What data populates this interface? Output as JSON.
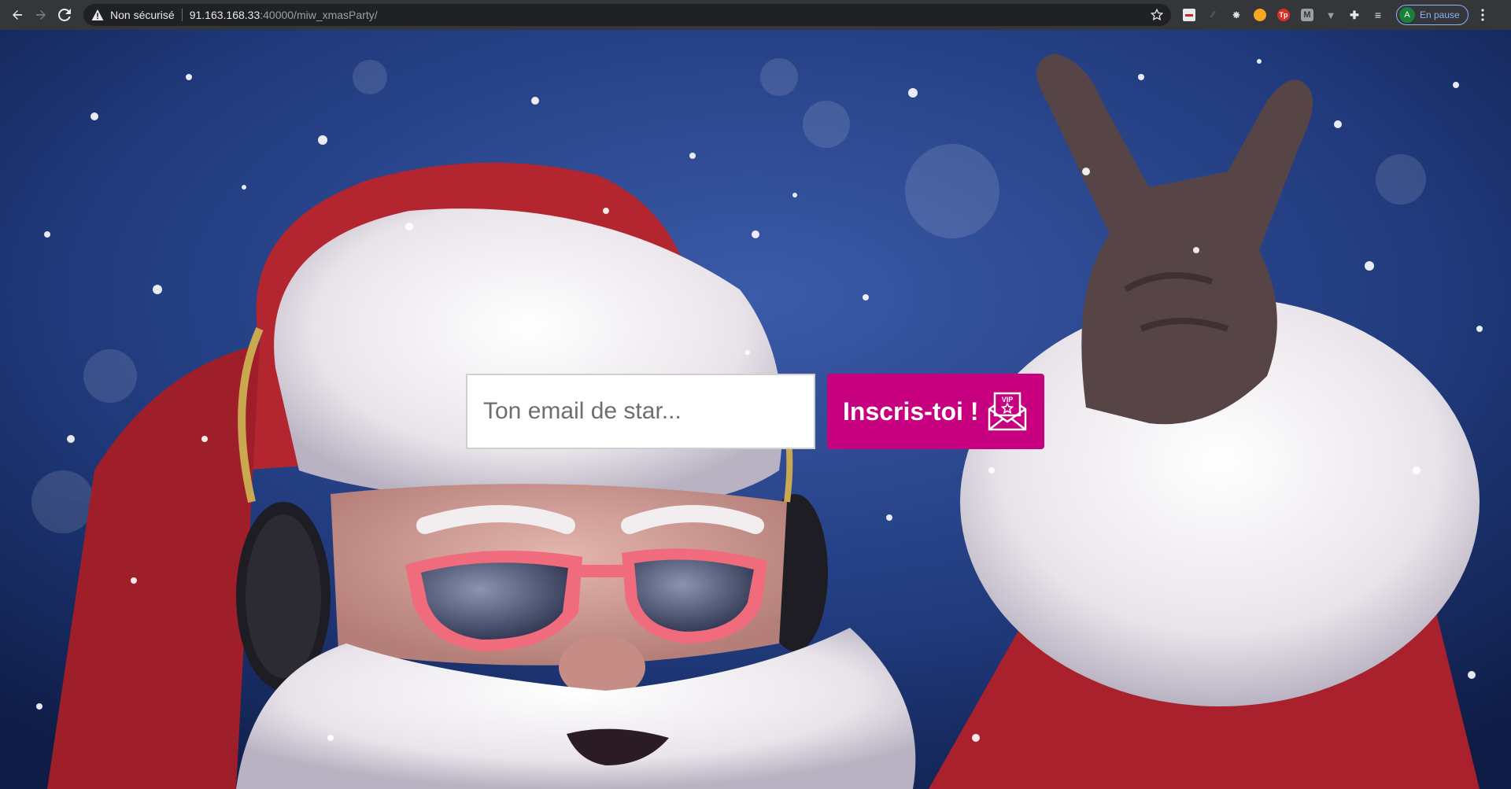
{
  "browser": {
    "security_label": "Non sécurisé",
    "url_host": "91.163.168.33",
    "url_path": ":40000/miw_xmasParty/",
    "profile_initial": "A",
    "profile_status": "En pause",
    "icons": [
      "back-icon",
      "forward-icon",
      "reload-icon",
      "warning-icon",
      "star-icon",
      "extensions-icon",
      "menu-icon"
    ]
  },
  "signup": {
    "email_placeholder": "Ton email de star...",
    "submit_label": "Inscris-toi !",
    "icon_text": "VIP"
  },
  "colors": {
    "button": "#c6007e",
    "chrome": "#35363a",
    "omnibox": "#202124",
    "accent": "#8ab4f8"
  }
}
